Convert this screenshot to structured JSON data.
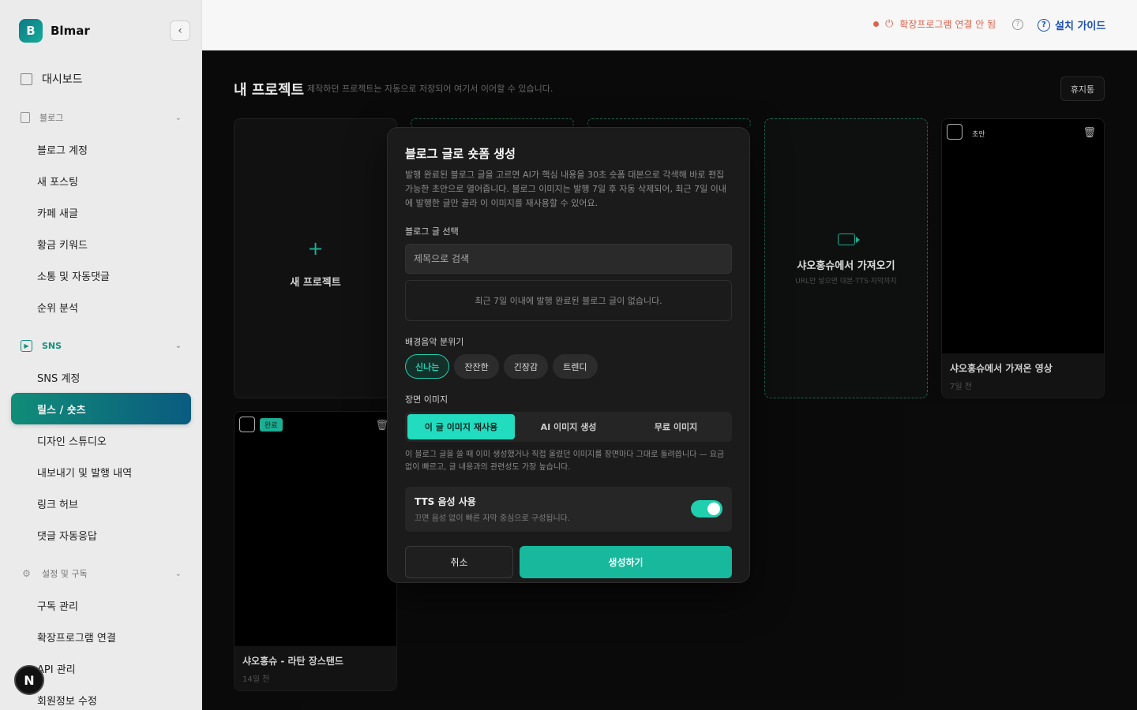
{
  "sidebar": {
    "brand_initial": "B",
    "brand_name": "Blmar",
    "collapse_icon": "‹",
    "dashboard_label": "대시보드",
    "blog_section_label": "블로그",
    "blog_items": [
      "블로그 계정",
      "새 포스팅",
      "카페 새글",
      "황금 키워드",
      "소통 및 자동댓글",
      "순위 분석"
    ],
    "sns_section_label": "SNS",
    "sns_items": [
      "SNS 계정",
      "릴스 / 숏츠",
      "디자인 스튜디오",
      "내보내기 및 발행 내역",
      "링크 허브",
      "댓글 자동응답"
    ],
    "settings_section_label": "설정 및 구독",
    "settings_items": [
      "구독 관리",
      "확장프로그램 연결",
      "API 관리",
      "회원정보 수정"
    ],
    "floating_badge": "N",
    "colors": {
      "accent": "#18967f",
      "active_gradient_start": "#12937d",
      "active_gradient_end": "#0b5f86"
    }
  },
  "header": {
    "extension_status": "확장프로그램 연결 안 됨",
    "help_icon": "?",
    "guide_label": "설치 가이드",
    "status_color": "#e0634f",
    "guide_color": "#1c4fb4"
  },
  "main": {
    "page_title": "내 프로젝트",
    "page_desc": "제작하던 프로젝트는 자동으로 저장되어 여기서 이어할 수 있습니다.",
    "trash_label": "휴지통",
    "new_project_label": "새 프로젝트",
    "plus_icon": "+",
    "import_title": "샤오홍슈에서 가져오기",
    "import_sub": "URL만 넣으면 대본·TTS·자막까지",
    "videos": [
      {
        "tag": "초안",
        "title": "샤오홍슈에서 가져온 영상",
        "time": "7일 전"
      },
      {
        "tag": "완료",
        "title": "샤오홍슈 - 라탄 장스탠드",
        "time": "14일 전"
      }
    ],
    "delete_icon": "🗑"
  },
  "modal": {
    "title": "블로그 글로 숏폼 생성",
    "description": "발행 완료된 블로그 글을 고르면 AI가 핵심 내용을 30초 숏폼 대본으로 각색해 바로 편집 가능한 초안으로 열어줍니다. 블로그 이미지는 발행 7일 후 자동 삭제되어, 최근 7일 이내에 발행한 글만 골라 이 이미지를 재사용할 수 있어요.",
    "post_select_label": "블로그 글 선택",
    "search_placeholder": "제목으로 검색",
    "empty_message": "최근 7일 이내에 발행 완료된 블로그 글이 없습니다.",
    "mood_label": "배경음악 분위기",
    "moods": [
      "신나는",
      "잔잔한",
      "긴장감",
      "트렌디"
    ],
    "mood_selected": "신나는",
    "scene_label": "장면 이미지",
    "scene_options": [
      "이 글 이미지 재사용",
      "AI 이미지 생성",
      "무료 이미지"
    ],
    "scene_selected": "이 글 이미지 재사용",
    "scene_desc": "이 블로그 글을 쓸 때 이미 생성했거나 직접 올렸던 이미지를 장면마다 그대로 돌려씁니다 — 요금 없이 빠르고, 글 내용과의 관련성도 가장 높습니다.",
    "tts_title": "TTS 음성 사용",
    "tts_sub": "끄면 음성 없이 빠른 자막 중심으로 구성됩니다.",
    "tts_enabled": true,
    "cancel_label": "취소",
    "create_label": "생성하기",
    "accent_color": "#17b89c"
  }
}
